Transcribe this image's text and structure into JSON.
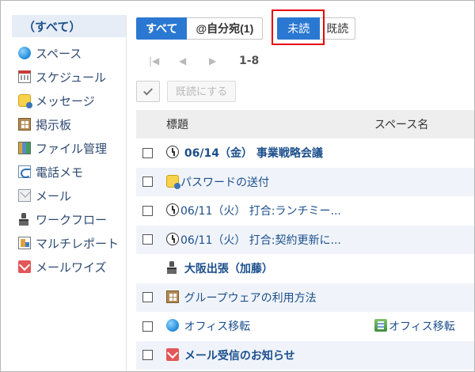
{
  "sidebar": {
    "items": [
      {
        "label": "（すべて）",
        "icon": "none"
      },
      {
        "label": "スペース",
        "icon": "space-icon"
      },
      {
        "label": "スケジュール",
        "icon": "calendar-icon"
      },
      {
        "label": "メッセージ",
        "icon": "message-icon"
      },
      {
        "label": "掲示板",
        "icon": "bulletin-board-icon"
      },
      {
        "label": "ファイル管理",
        "icon": "file-cabinet-icon"
      },
      {
        "label": "電話メモ",
        "icon": "phone-memo-icon"
      },
      {
        "label": "メール",
        "icon": "mail-icon"
      },
      {
        "label": "ワークフロー",
        "icon": "workflow-stamp-icon"
      },
      {
        "label": "マルチレポート",
        "icon": "report-icon"
      },
      {
        "label": "メールワイズ",
        "icon": "mailwise-icon"
      }
    ]
  },
  "filters": {
    "all": "すべて",
    "to_me": "@自分宛(1)",
    "unread": "未読",
    "read": "既読"
  },
  "pager": {
    "first": "◀",
    "prev": "◀",
    "next": "▶",
    "range": "1-8"
  },
  "actions": {
    "mark_read": "既読にする"
  },
  "table": {
    "headers": {
      "title": "標題",
      "space": "スペース名"
    },
    "rows": [
      {
        "title": "06/14（金） 事業戦略会議",
        "space": "",
        "icon": "clock-icon",
        "bold": true,
        "checkbox": true
      },
      {
        "title": "パスワードの送付",
        "space": "",
        "icon": "message-icon",
        "bold": false,
        "checkbox": true
      },
      {
        "title": "06/11（火） 打合:ランチミー...",
        "space": "",
        "icon": "clock-icon",
        "bold": false,
        "checkbox": true
      },
      {
        "title": "06/11（火） 打合:契約更新に...",
        "space": "",
        "icon": "clock-icon",
        "bold": false,
        "checkbox": true
      },
      {
        "title": "大阪出張（加藤）",
        "space": "",
        "icon": "workflow-stamp-icon",
        "bold": true,
        "checkbox": false
      },
      {
        "title": "グループウェアの利用方法",
        "space": "",
        "icon": "bulletin-board-icon",
        "bold": false,
        "checkbox": true
      },
      {
        "title": "オフィス移転",
        "space": "オフィス移転",
        "icon": "space-icon",
        "bold": false,
        "checkbox": true
      },
      {
        "title": "メール受信のお知らせ",
        "space": "",
        "icon": "mailwise-icon",
        "bold": true,
        "checkbox": true
      }
    ]
  },
  "colors": {
    "accent": "#2b78d2",
    "link": "#1c4f8c",
    "highlight_frame": "#e60000",
    "row_alt": "#f0f4fa"
  }
}
